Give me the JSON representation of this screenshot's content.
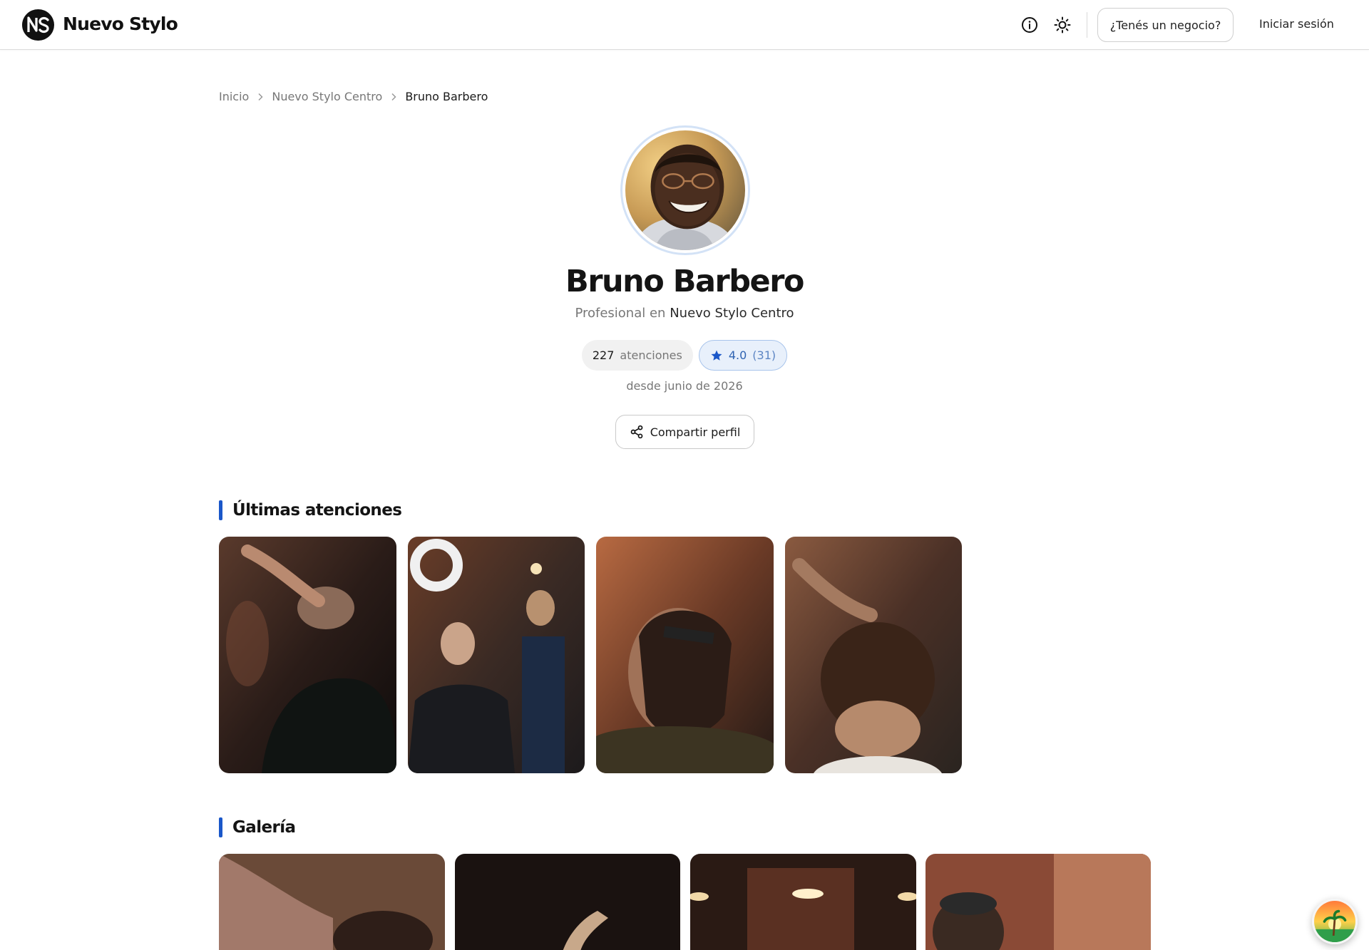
{
  "header": {
    "brand": "Nuevo Stylo",
    "business_button": "¿Tenés un negocio?",
    "login": "Iniciar sesión"
  },
  "breadcrumb": {
    "items": [
      "Inicio",
      "Nuevo Stylo Centro"
    ],
    "current": "Bruno Barbero"
  },
  "profile": {
    "name": "Bruno Barbero",
    "role_prefix": "Profesional en",
    "venue": "Nuevo Stylo Centro",
    "appointments_count": "227",
    "appointments_label": "atenciones",
    "rating": "4.0",
    "rating_count": "(31)",
    "since": "desde junio de 2026",
    "share_button": "Compartir perfil"
  },
  "sections": {
    "recent_title": "Últimas atenciones",
    "gallery_title": "Galería"
  },
  "colors": {
    "accent": "#1a57c9",
    "rating_bg": "#e8f0fb",
    "rating_text": "#2f63b2"
  }
}
